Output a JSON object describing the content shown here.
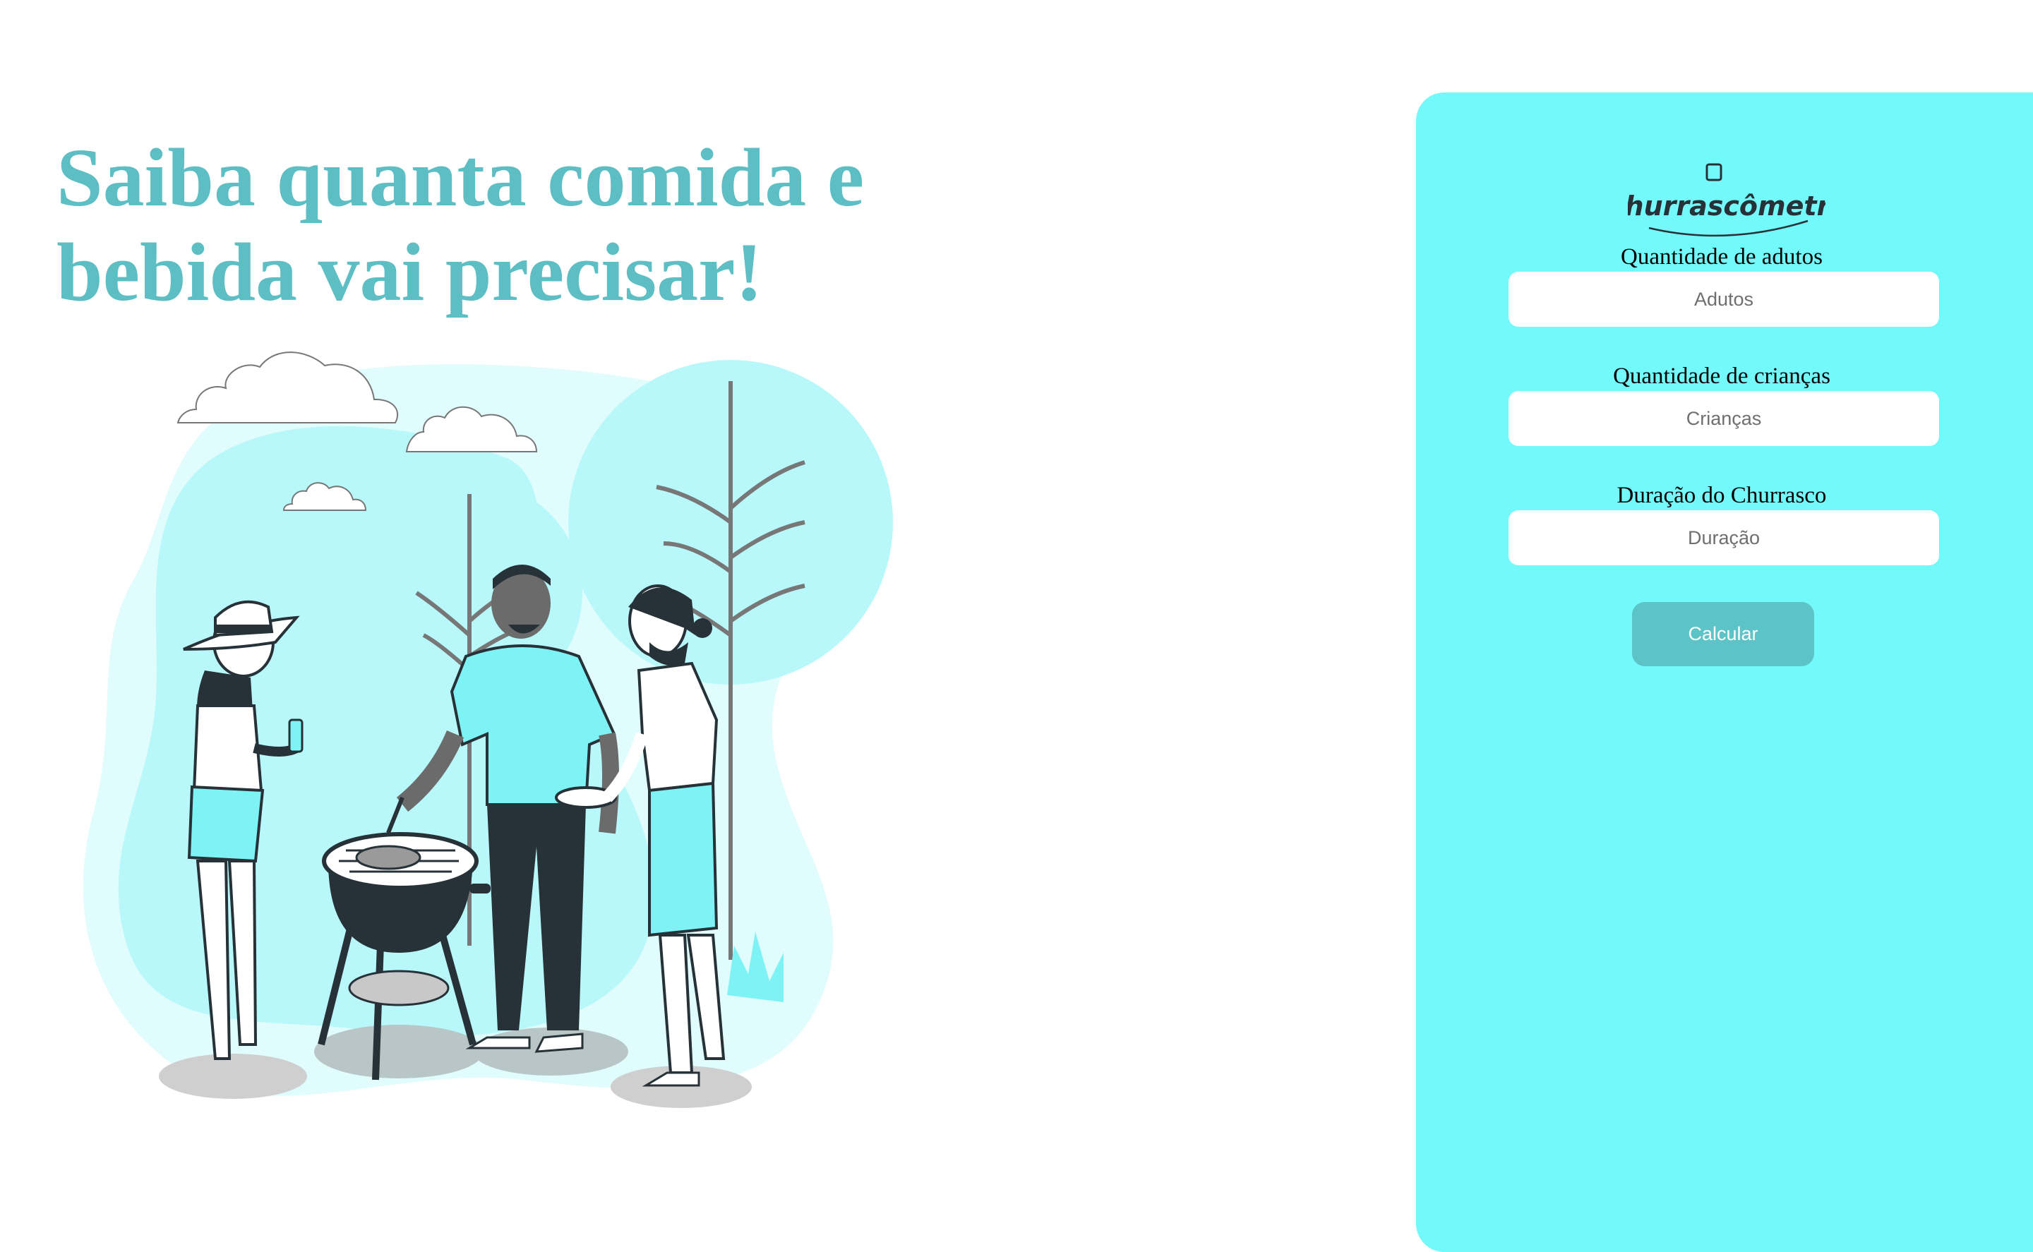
{
  "hero": {
    "headline_line1": "Saiba quanta comida e",
    "headline_line2": "bebida vai precisar!"
  },
  "logo": {
    "text": "Churrascômetro"
  },
  "form": {
    "adults": {
      "label": "Quantidade de adutos",
      "placeholder": "Adutos",
      "value": ""
    },
    "children": {
      "label": "Quantidade de crianças",
      "placeholder": "Crianças",
      "value": ""
    },
    "duration": {
      "label": "Duração do Churrasco",
      "placeholder": "Duração",
      "value": ""
    },
    "submit_label": "Calcular"
  },
  "colors": {
    "accent": "#5dbfc4",
    "panel_background": "#74f9fb",
    "button": "#5cc3c7",
    "illustration_teal": "#7ef3f6",
    "illustration_dark": "#263238"
  }
}
